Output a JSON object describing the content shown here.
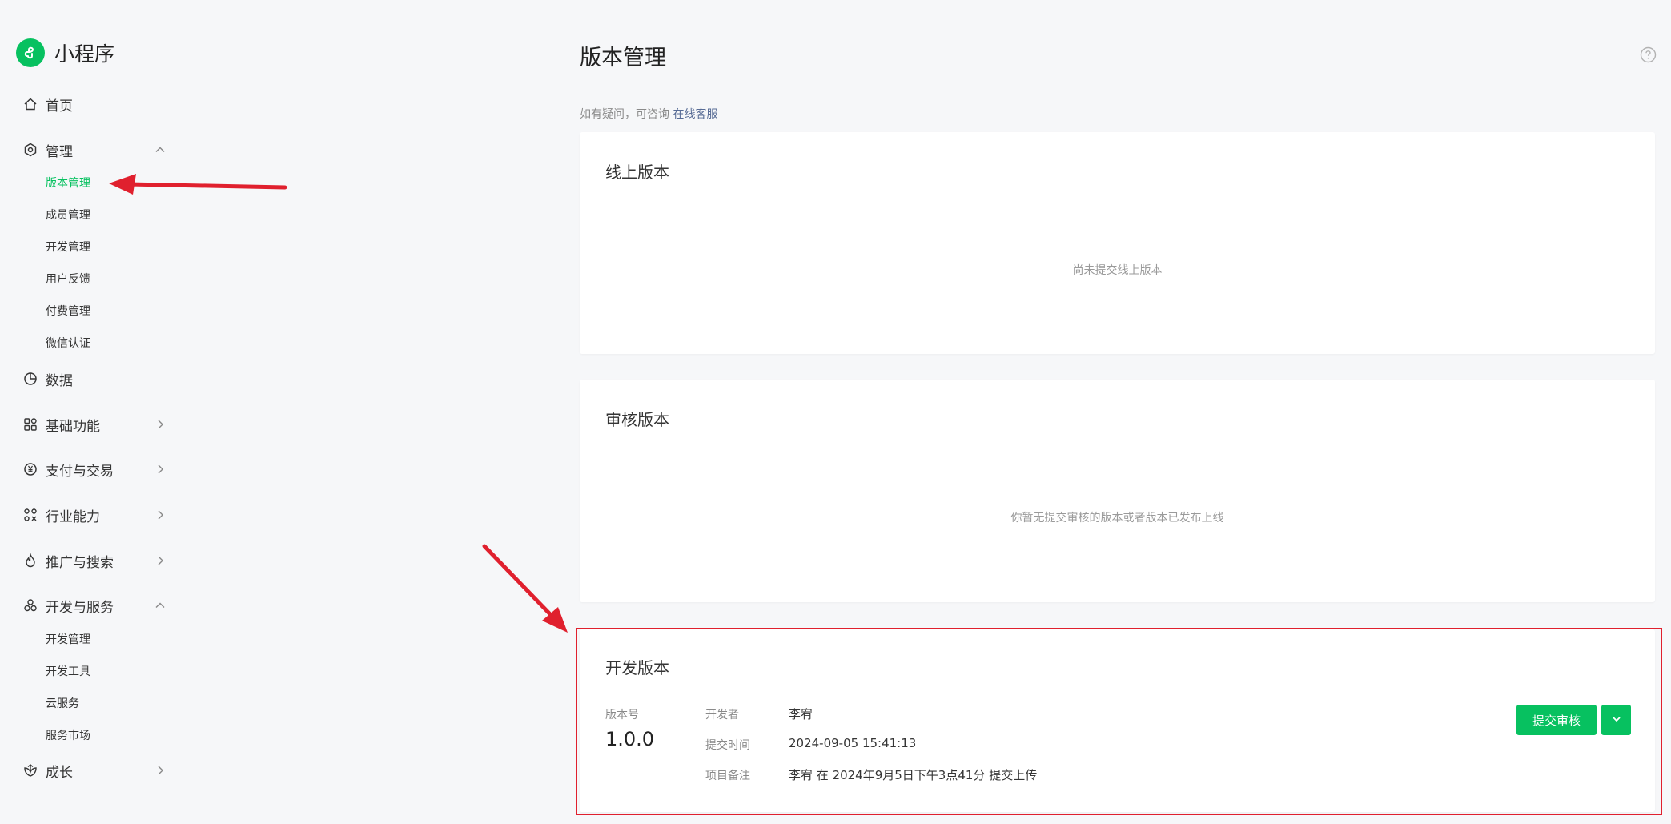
{
  "brand": {
    "name": "小程序"
  },
  "sidebar": {
    "home": "首页",
    "manage": {
      "label": "管理",
      "items": [
        "版本管理",
        "成员管理",
        "开发管理",
        "用户反馈",
        "付费管理",
        "微信认证"
      ]
    },
    "data": "数据",
    "basic": "基础功能",
    "pay": "支付与交易",
    "industry": "行业能力",
    "promote": "推广与搜索",
    "devservice": {
      "label": "开发与服务",
      "items": [
        "开发管理",
        "开发工具",
        "云服务",
        "服务市场"
      ]
    },
    "growth": "成长"
  },
  "page": {
    "title": "版本管理",
    "hint": "如有疑问，可咨询",
    "hint_link": "在线客服"
  },
  "online": {
    "title": "线上版本",
    "empty": "尚未提交线上版本"
  },
  "review": {
    "title": "审核版本",
    "empty": "你暂无提交审核的版本或者版本已发布上线"
  },
  "dev": {
    "title": "开发版本",
    "version_label": "版本号",
    "version": "1.0.0",
    "developer_label": "开发者",
    "developer": "李宥",
    "time_label": "提交时间",
    "time": "2024-09-05 15:41:13",
    "note_label": "项目备注",
    "note": "李宥 在 2024年9月5日下午3点41分 提交上传",
    "submit_label": "提交审核"
  },
  "colors": {
    "accent": "#07c160",
    "annotation": "#e0202e",
    "link": "#576b95"
  }
}
